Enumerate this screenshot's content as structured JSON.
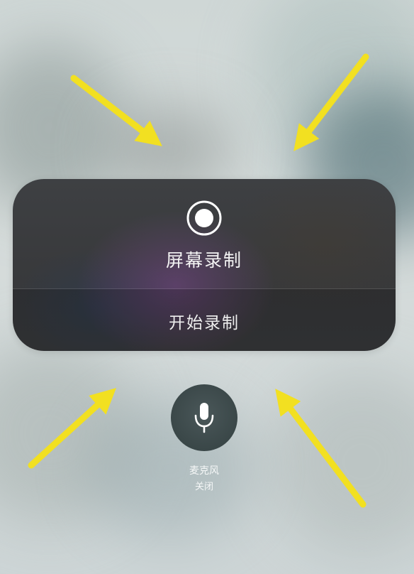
{
  "screen_recording": {
    "title": "屏幕录制",
    "start_button_label": "开始录制",
    "record_icon": "record-icon"
  },
  "microphone": {
    "label": "麦克风",
    "status": "关闭",
    "icon": "microphone-icon"
  },
  "annotation": {
    "arrow_color": "#f2e021",
    "arrow_count": 4
  }
}
